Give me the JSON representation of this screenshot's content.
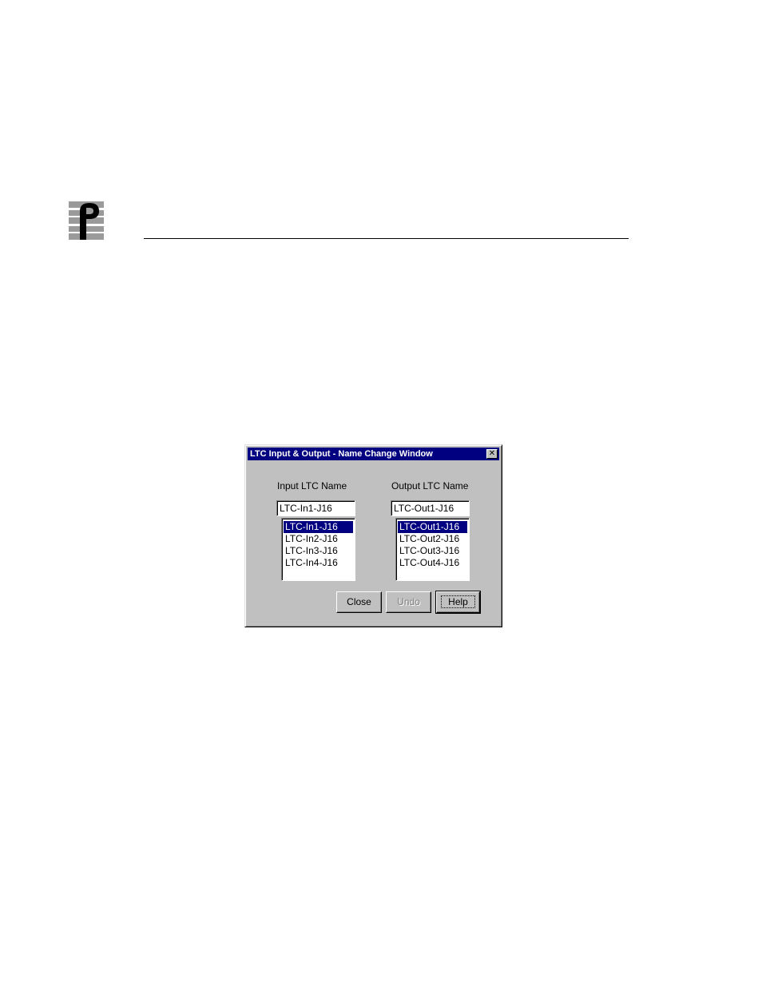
{
  "dialog": {
    "title": "LTC Input & Output - Name Change Window",
    "close_glyph": "✕"
  },
  "input": {
    "label": "Input LTC Name",
    "value": "LTC-In1-J16",
    "items": [
      "LTC-In1-J16",
      "LTC-In2-J16",
      "LTC-In3-J16",
      "LTC-In4-J16"
    ],
    "selected_index": 0
  },
  "output": {
    "label": "Output LTC Name",
    "value": "LTC-Out1-J16",
    "items": [
      "LTC-Out1-J16",
      "LTC-Out2-J16",
      "LTC-Out3-J16",
      "LTC-Out4-J16"
    ],
    "selected_index": 0
  },
  "buttons": {
    "close": "Close",
    "undo": "Undo",
    "help": "Help"
  },
  "colors": {
    "titlebar": "#000080",
    "face": "#c0c0c0",
    "selection": "#000080"
  }
}
